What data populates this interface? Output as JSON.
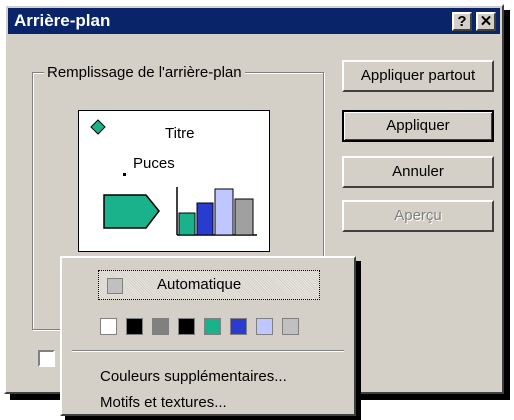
{
  "window": {
    "title": "Arrière-plan",
    "help_label": "?",
    "close_label": "✕"
  },
  "group": {
    "label": "Remplissage de l'arrière-plan"
  },
  "preview": {
    "title_text": "Titre",
    "bullet_text": "Puces"
  },
  "buttons": {
    "apply_all": "Appliquer partout",
    "apply": "Appliquer",
    "cancel": "Annuler",
    "preview": "Aperçu"
  },
  "popup": {
    "automatic": "Automatique",
    "swatches": [
      "#ffffff",
      "#000000",
      "#808080",
      "#000000",
      "#1ab28a",
      "#2a3bd0",
      "#c0c6ff",
      "#c0c0c0"
    ],
    "more_colors": "Couleurs supplémentaires...",
    "patterns": "Motifs et textures..."
  },
  "colors": {
    "title_bar": "#0a246a",
    "face": "#d4d0c8"
  }
}
